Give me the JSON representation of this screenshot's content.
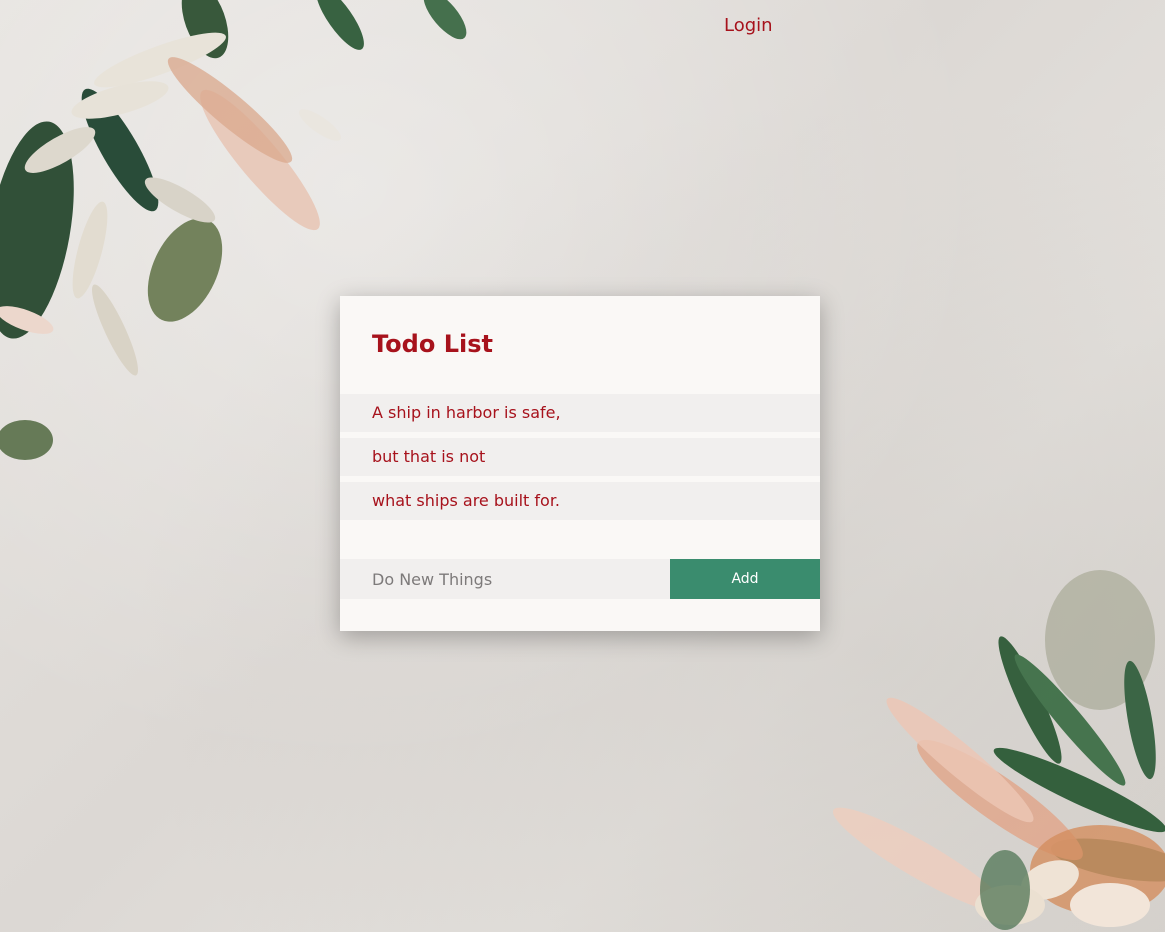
{
  "nav": {
    "login_label": "Login"
  },
  "todo": {
    "title": "Todo List",
    "items": [
      "A ship in harbor is safe,",
      "but that is not",
      "what ships are built for."
    ],
    "new_item_placeholder": "Do New Things",
    "add_label": "Add"
  },
  "colors": {
    "accent": "#a7121c",
    "button": "#3a8c6e",
    "card_background": "#faf8f6",
    "item_background": "#f1efee"
  }
}
